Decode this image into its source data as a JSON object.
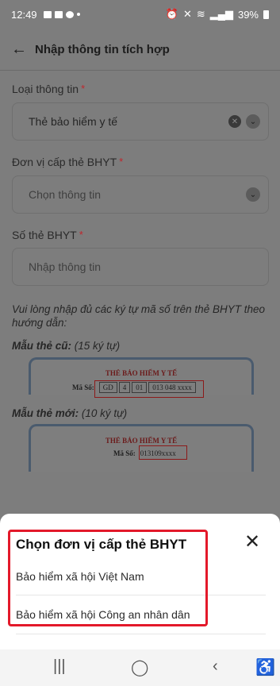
{
  "status": {
    "time": "12:49",
    "battery": "39%"
  },
  "header": {
    "title": "Nhập thông tin tích hợp"
  },
  "form": {
    "type_label": "Loại thông tin",
    "type_value": "Thẻ bảo hiểm y tế",
    "unit_label": "Đơn vị cấp thẻ BHYT",
    "unit_placeholder": "Chọn thông tin",
    "card_label": "Số thẻ BHYT",
    "card_placeholder": "Nhập thông tin",
    "required_mark": "*"
  },
  "hint": "Vui lòng nhập đủ các ký tự mã số trên thẻ BHYT theo hướng dẫn:",
  "old_sample": {
    "title_bold": "Mẫu thẻ cũ:",
    "title_rest": " (15 ký tự)",
    "card_title": "THẺ BẢO HIỂM Y TẾ",
    "ma_so": "Mã Số:",
    "parts": [
      "GD",
      "4",
      "01",
      "013 048 xxxx"
    ]
  },
  "new_sample": {
    "title_bold": "Mẫu thẻ mới:",
    "title_rest": " (10 ký tự)",
    "card_title": "THẺ BẢO HIỂM Y TẾ",
    "ma_so": "Mã Số:",
    "code": "013109xxxx"
  },
  "sheet": {
    "title": "Chọn đơn vị cấp thẻ BHYT",
    "options": [
      "Bảo hiểm xã hội Việt Nam",
      "Bảo hiểm xã hội Công an nhân dân"
    ]
  }
}
